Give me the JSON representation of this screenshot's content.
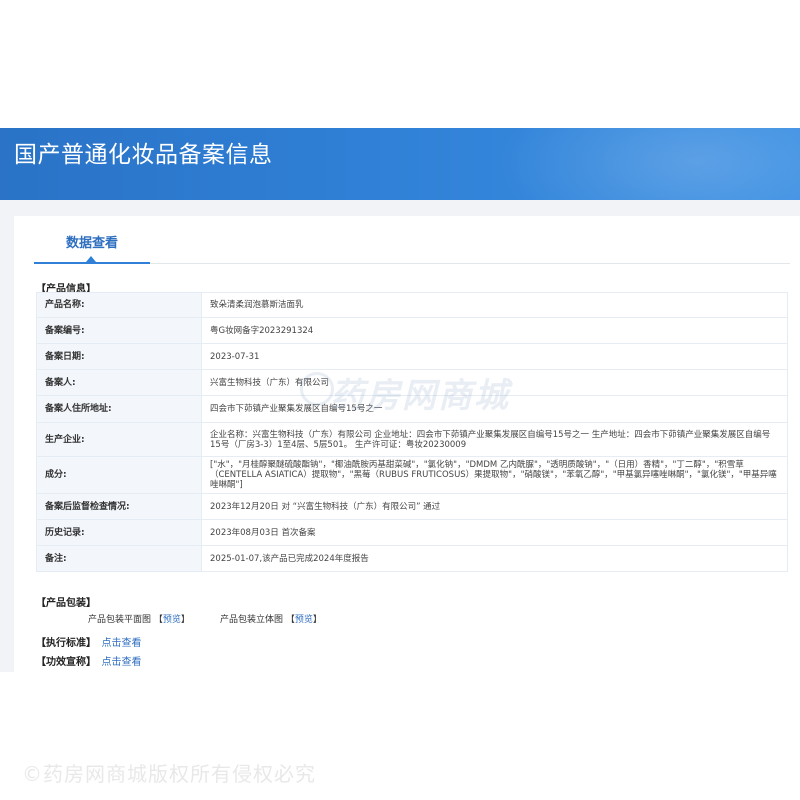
{
  "header": {
    "title": "国产普通化妆品备案信息"
  },
  "tabs": [
    {
      "label": "数据查看"
    }
  ],
  "product_info": {
    "section_label": "【产品信息】",
    "rows": [
      {
        "key": "产品名称:",
        "value": "致朵清柔润泡慕斯洁面乳"
      },
      {
        "key": "备案编号:",
        "value": "粤G妆网备字2023291324"
      },
      {
        "key": "备案日期:",
        "value": "2023-07-31"
      },
      {
        "key": "备案人:",
        "value": "兴富生物科技（广东）有限公司"
      },
      {
        "key": "备案人住所地址:",
        "value": "四会市下茆镇产业聚集发展区自编号15号之一"
      },
      {
        "key": "生产企业:",
        "value": "企业名称：兴富生物科技（广东）有限公司 企业地址：四会市下茆镇产业聚集发展区自编号15号之一 生产地址：四会市下茆镇产业聚集发展区自编号15号（厂房3-3）1至4层、5层501。 生产许可证：粤妆20230009"
      },
      {
        "key": "成分:",
        "value": "[\"水\"，\"月桂醇聚醚硫酸酯钠\"，\"椰油酰胺丙基甜菜碱\"，\"氯化钠\"，\"DMDM 乙内酰脲\"，\"透明质酸钠\"，\"（日用）香精\"，\"丁二醇\"，\"积雪草（CENTELLA ASIATICA）提取物\"，\"黑莓（RUBUS FRUTICOSUS）果提取物\"，\"硝酸镁\"，\"苯氧乙醇\"，\"甲基氯异噻唑啉酮\"，\"氯化镁\"，\"甲基异噻唑啉酮\"]"
      },
      {
        "key": "备案后监督检查情况:",
        "value": "2023年12月20日 对 “兴富生物科技（广东）有限公司” 通过"
      },
      {
        "key": "历史记录:",
        "value": "2023年08月03日 首次备案"
      },
      {
        "key": "备注:",
        "value": "2025-01-07,该产品已完成2024年度报告"
      }
    ]
  },
  "package": {
    "section_label": "【产品包装】",
    "flat": {
      "label": "产品包装平面图",
      "link": "预览"
    },
    "solid": {
      "label": "产品包装立体图",
      "link": "预览"
    }
  },
  "standard": {
    "section_label": "【执行标准】",
    "link": "点击查看"
  },
  "efficacy": {
    "section_label": "【功效宣称】",
    "link": "点击查看"
  },
  "watermark": {
    "text": "药房网商城"
  },
  "copyright": {
    "text": "©药房网商城版权所有侵权必究"
  }
}
